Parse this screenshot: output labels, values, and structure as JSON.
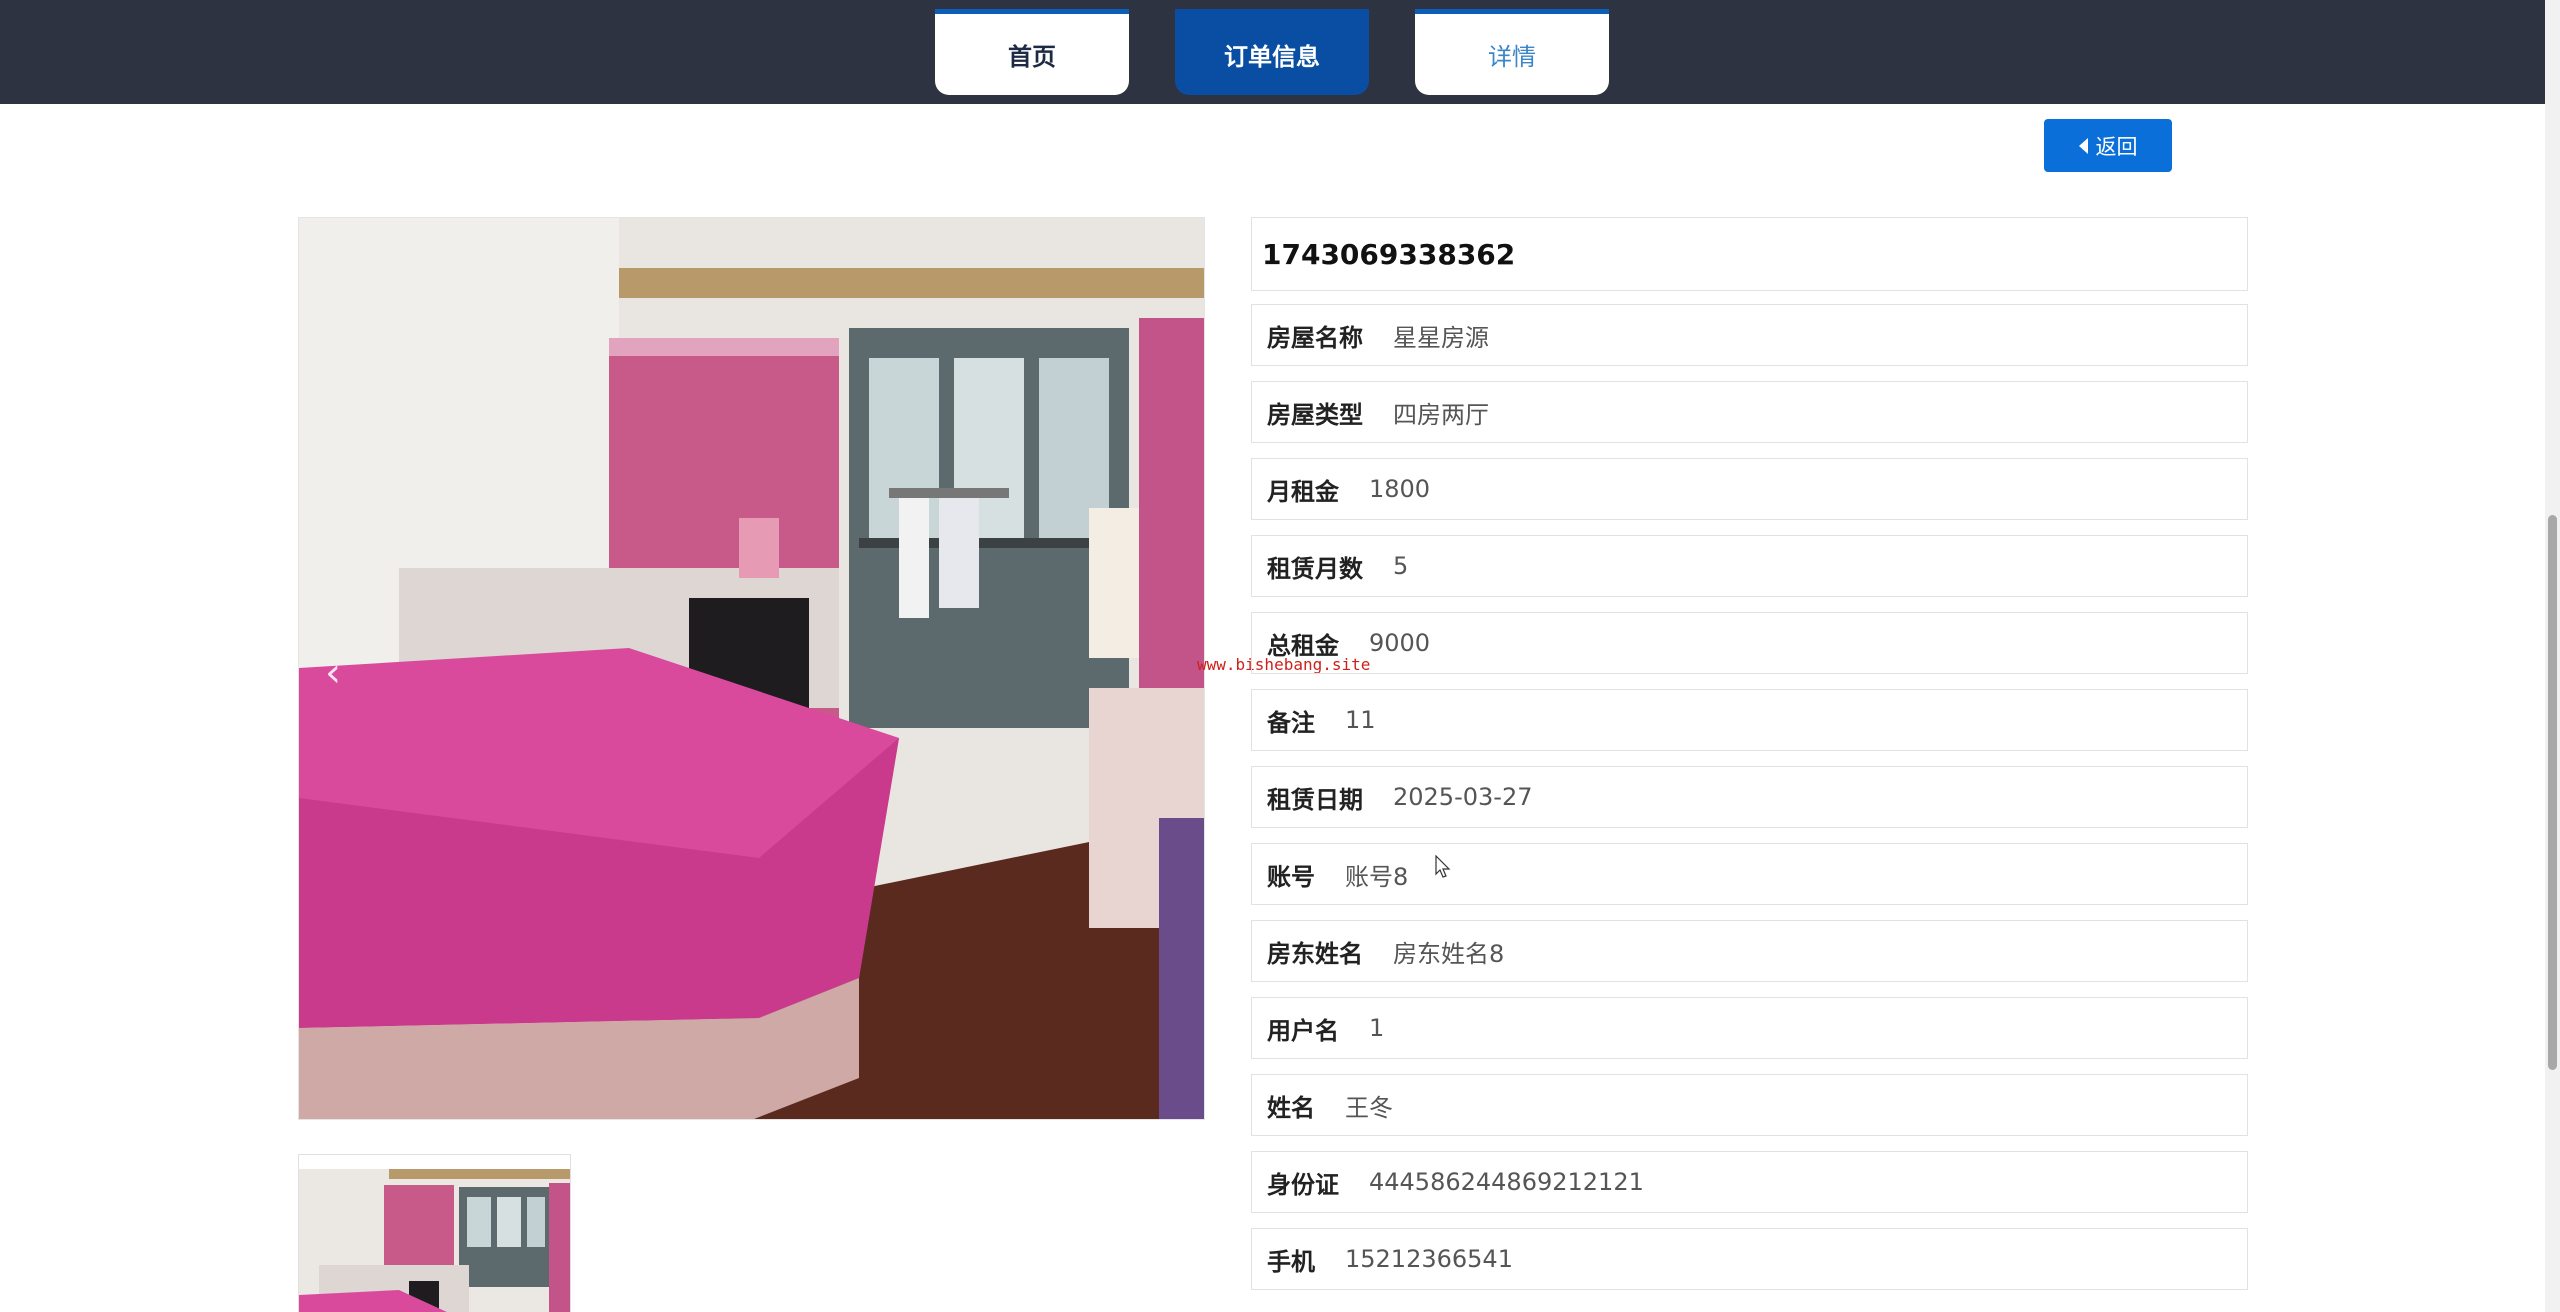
{
  "nav": {
    "tabs": [
      {
        "label": "首页"
      },
      {
        "label": "订单信息"
      },
      {
        "label": "详情"
      }
    ]
  },
  "back_button": {
    "label": "返回",
    "icon": "caret-left-icon"
  },
  "watermark": "www.bishebang.site",
  "order": {
    "id": "1743069338362",
    "fields": [
      {
        "label": "房屋名称",
        "value": "星星房源"
      },
      {
        "label": "房屋类型",
        "value": "四房两厅"
      },
      {
        "label": "月租金",
        "value": "1800"
      },
      {
        "label": "租赁月数",
        "value": "5"
      },
      {
        "label": "总租金",
        "value": "9000"
      },
      {
        "label": "备注",
        "value": "11"
      },
      {
        "label": "租赁日期",
        "value": "2025-03-27"
      },
      {
        "label": "账号",
        "value": "账号8"
      },
      {
        "label": "房东姓名",
        "value": "房东姓名8"
      },
      {
        "label": "用户名",
        "value": "1"
      },
      {
        "label": "姓名",
        "value": "王冬"
      },
      {
        "label": "身份证",
        "value": "444586244869212121"
      },
      {
        "label": "手机",
        "value": "15212366541"
      }
    ]
  },
  "colors": {
    "topbar": "#2e3341",
    "active_tab": "#0a4ea3",
    "primary_button": "#0a6fd8"
  }
}
